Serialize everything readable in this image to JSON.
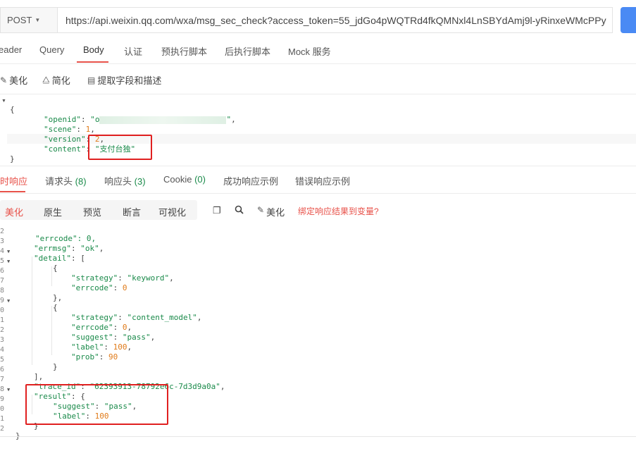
{
  "request": {
    "method": "POST",
    "url": "https://api.weixin.qq.com/wxa/msg_sec_check?access_token=55_jdGo4pWQTRd4fkQMNxl4LnSBYdAmj9l-yRinxeWMcPPy"
  },
  "tabs": [
    "eader",
    "Query",
    "Body",
    "认证",
    "预执行脚本",
    "后执行脚本",
    "Mock 服务"
  ],
  "body_toolbar": {
    "beautify": "美化",
    "simplify": "简化",
    "extract": "提取字段和描述"
  },
  "request_body": {
    "open_brace": "{",
    "close_brace": "}",
    "openid_key": "\"openid\"",
    "openid_prefix": "\"o",
    "openid_tail": "\"",
    "scene_key": "\"scene\"",
    "scene_val": "1",
    "version_key": "\"version\"",
    "version_val": "2",
    "content_key": "\"content\"",
    "content_val": "\"支付台独\""
  },
  "response_tabs": {
    "real": "时响应",
    "req_headers": "请求头",
    "req_headers_count": "(8)",
    "res_headers": "响应头",
    "res_headers_count": "(3)",
    "cookie": "Cookie",
    "cookie_count": "(0)",
    "success_example": "成功响应示例",
    "error_example": "错误响应示例"
  },
  "view_modes": [
    "美化",
    "原生",
    "预览",
    "断言",
    "可视化"
  ],
  "response_toolbar": {
    "beautify": "美化",
    "bind_link": "绑定响应结果到变量?"
  },
  "line_numbers": [
    "2",
    "3",
    "4",
    "5",
    "6",
    "7",
    "8",
    "9",
    "0",
    "1",
    "2",
    "3",
    "4",
    "5",
    "6",
    "7",
    "8",
    "9",
    "0",
    "1",
    "2"
  ],
  "fold_lines": [
    "4",
    "5",
    "9",
    "8"
  ],
  "response_body": {
    "errcode_top": "\"errcode\": 0,",
    "errmsg_key": "\"errmsg\"",
    "errmsg_val": "\"ok\"",
    "detail_key": "\"detail\"",
    "strategy_key": "\"strategy\"",
    "strategy1_val": "\"keyword\"",
    "errcode_key": "\"errcode\"",
    "errcode1_val": "0",
    "strategy2_val": "\"content_model\"",
    "errcode2_val": "0",
    "suggest_key": "\"suggest\"",
    "suggest_val": "\"pass\"",
    "label_key": "\"label\"",
    "label_val": "100",
    "prob_key": "\"prob\"",
    "prob_val": "90",
    "trace_key": "\"trace_id\"",
    "trace_val": "\"62393913-78792e6c-7d3d9a0a\"",
    "result_key": "\"result\"",
    "result_suggest_val": "\"pass\"",
    "result_label_val": "100"
  },
  "colors": {
    "accent": "#e8524a",
    "key": "#1a8a4a",
    "number": "#e07b1a",
    "highlight_box": "#e02020",
    "send": "#4a8af4"
  }
}
